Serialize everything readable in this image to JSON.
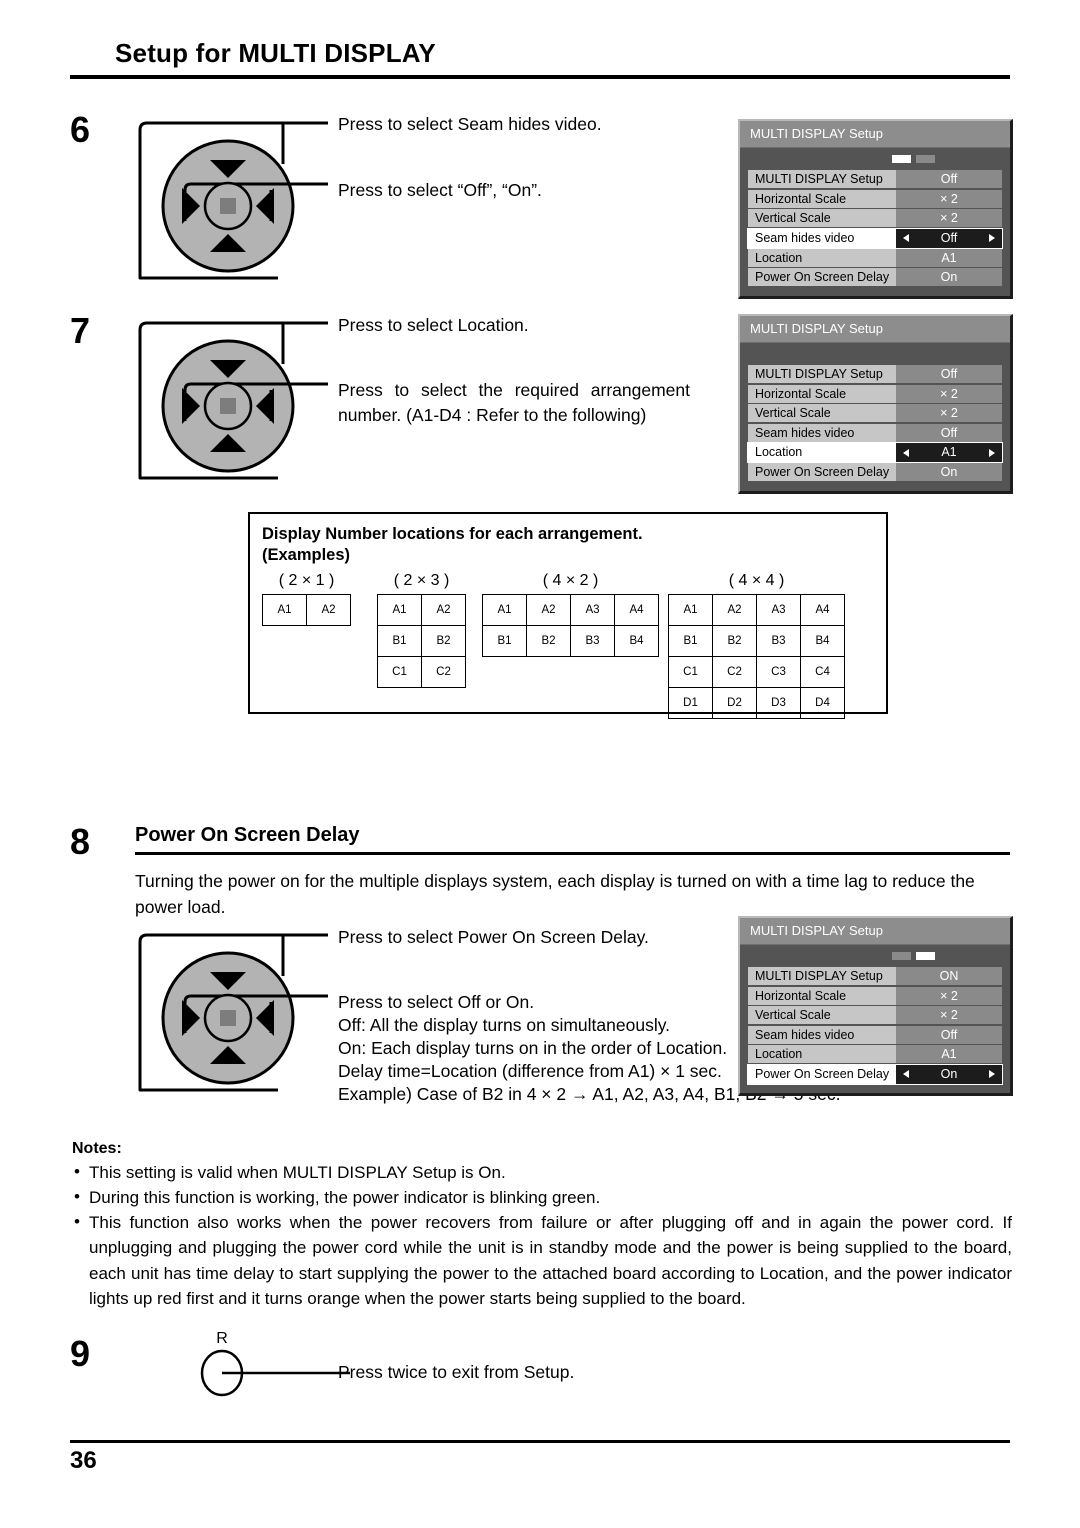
{
  "header": {
    "title": "Setup for MULTI DISPLAY"
  },
  "steps": {
    "six": "6",
    "seven": "7",
    "eight": "8",
    "nine": "9"
  },
  "step6": {
    "line1": "Press to select Seam hides video.",
    "line2": "Press to select “Off”, “On”."
  },
  "step7": {
    "line1": "Press to select Location.",
    "line2": "Press to select the required arrangement number. (A1-D4 : Refer to the following)"
  },
  "step8": {
    "heading": "Power On Screen Delay",
    "intro": "Turning the power on for the multiple displays system, each display is turned on with a time lag to reduce the power load.",
    "line1": "Press to select Power On Screen Delay.",
    "line2": "Press to select Off or On.",
    "line3": "Off: All the display turns on simultaneously.",
    "line4": "On: Each display turns on in the order of Location.",
    "line5": "Delay time=Location (difference from A1) × 1 sec.",
    "line6": "Example) Case of B2 in 4 × 2 → A1, A2, A3, A4, B1, B2 → 5 sec."
  },
  "step9": {
    "button": "R",
    "text": "Press twice to exit from Setup."
  },
  "arrangement": {
    "title_line1": "Display Number locations for each arrangement.",
    "title_line2": "(Examples)",
    "groups": [
      {
        "caption": "( 2 × 1 )",
        "rows": [
          [
            "A1",
            "A2"
          ]
        ]
      },
      {
        "caption": "( 2 × 3 )",
        "rows": [
          [
            "A1",
            "A2"
          ],
          [
            "B1",
            "B2"
          ],
          [
            "C1",
            "C2"
          ]
        ]
      },
      {
        "caption": "( 4 × 2 )",
        "rows": [
          [
            "A1",
            "A2",
            "A3",
            "A4"
          ],
          [
            "B1",
            "B2",
            "B3",
            "B4"
          ]
        ]
      },
      {
        "caption": "( 4 × 4 )",
        "rows": [
          [
            "A1",
            "A2",
            "A3",
            "A4"
          ],
          [
            "B1",
            "B2",
            "B3",
            "B4"
          ],
          [
            "C1",
            "C2",
            "C3",
            "C4"
          ],
          [
            "D1",
            "D2",
            "D3",
            "D4"
          ]
        ]
      }
    ]
  },
  "osd": {
    "title": "MULTI DISPLAY Setup",
    "panel1": {
      "indicator": [
        "on",
        "off"
      ],
      "rows": [
        {
          "label": "MULTI DISPLAY Setup",
          "value": "Off",
          "selected": false
        },
        {
          "label": "Horizontal Scale",
          "value": "× 2",
          "selected": false
        },
        {
          "label": "Vertical Scale",
          "value": "× 2",
          "selected": false
        },
        {
          "label": "Seam hides video",
          "value": "Off",
          "selected": true
        },
        {
          "label": "Location",
          "value": "A1",
          "selected": false
        },
        {
          "label": "Power On Screen Delay",
          "value": "On",
          "selected": false
        }
      ]
    },
    "panel2": {
      "indicator": [
        "none",
        "none"
      ],
      "rows": [
        {
          "label": "MULTI DISPLAY Setup",
          "value": "Off",
          "selected": false
        },
        {
          "label": "Horizontal Scale",
          "value": "× 2",
          "selected": false
        },
        {
          "label": "Vertical Scale",
          "value": "× 2",
          "selected": false
        },
        {
          "label": "Seam hides video",
          "value": "Off",
          "selected": false
        },
        {
          "label": "Location",
          "value": "A1",
          "selected": true
        },
        {
          "label": "Power On Screen Delay",
          "value": "On",
          "selected": false
        }
      ]
    },
    "panel3": {
      "indicator": [
        "off",
        "on"
      ],
      "rows": [
        {
          "label": "MULTI DISPLAY Setup",
          "value": "ON",
          "selected": false
        },
        {
          "label": "Horizontal Scale",
          "value": "× 2",
          "selected": false
        },
        {
          "label": "Vertical Scale",
          "value": "× 2",
          "selected": false
        },
        {
          "label": "Seam hides video",
          "value": "Off",
          "selected": false
        },
        {
          "label": "Location",
          "value": "A1",
          "selected": false
        },
        {
          "label": "Power On Screen Delay",
          "value": "On",
          "selected": true
        }
      ]
    }
  },
  "notes": {
    "heading": "Notes:",
    "bullet": "•",
    "items": [
      "This setting is valid when MULTI DISPLAY Setup is On.",
      "During this function is working, the power indicator is blinking green.",
      "This function also works when the power recovers from failure or after plugging off and in again the power cord. If unplugging and plugging the power cord while the unit is in standby mode and the power is being supplied to the board, each unit has time delay to start supplying the power to the attached board according to Location, and the power indicator lights up red first and it turns orange when the power starts being supplied to the board."
    ]
  },
  "footer": {
    "page_number": "36"
  }
}
